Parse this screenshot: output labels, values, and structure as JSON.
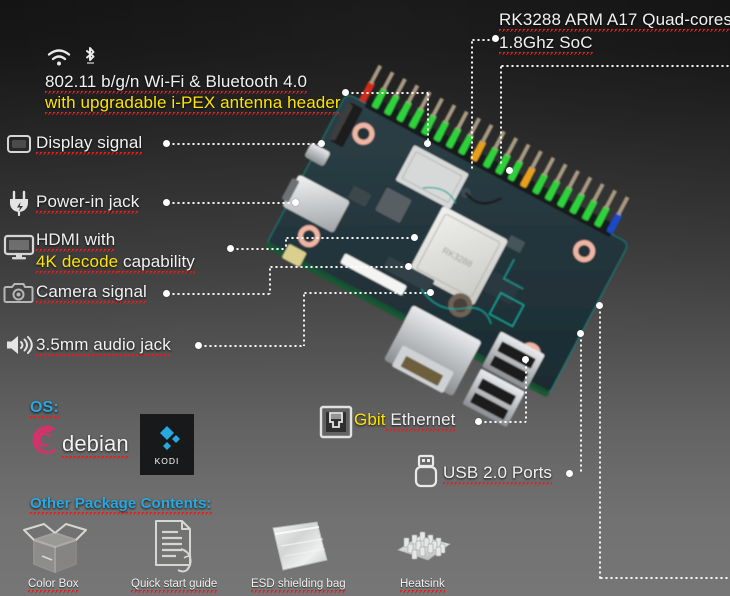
{
  "product": {
    "board_name": "single-board-computer",
    "background": {
      "top_color": "#111111",
      "bottom_color": "#767676"
    }
  },
  "accent_colors": {
    "highlight_yellow": "#ffe400",
    "cyan": "#29a8e0",
    "text": "#f2f2f2",
    "spell_underline": "#e02020"
  },
  "annotations": [
    {
      "id": "wifi-bt",
      "icon": [
        "wifi-icon",
        "bluetooth-icon"
      ],
      "line1": "802.11 b/g/n Wi-Fi  & Bluetooth 4.0",
      "line2": "with upgradable i-PEX antenna header",
      "line2_highlight": true
    },
    {
      "id": "display-signal",
      "icon": "display-connector-icon",
      "text": "Display signal"
    },
    {
      "id": "power-in-jack",
      "icon": "power-plug-icon",
      "text": "Power-in jack"
    },
    {
      "id": "hdmi",
      "icon": "monitor-icon",
      "line1": "HDMI with",
      "line2_prefix": "4K decode",
      "line2_suffix": " capability"
    },
    {
      "id": "camera-signal",
      "icon": "camera-icon",
      "text": "Camera signal"
    },
    {
      "id": "audio-jack",
      "icon": "speaker-icon",
      "text": "3.5mm audio jack"
    },
    {
      "id": "soc",
      "line1": "RK3288 ARM A17 Quad-cores",
      "line2": "1.8Ghz SoC"
    },
    {
      "id": "gbit-ethernet",
      "icon": "rj45-icon",
      "prefix": "Gbit",
      "suffix": " Ethernet"
    },
    {
      "id": "usb-ports",
      "icon": "usb-icon",
      "text": "USB 2.0 Ports"
    }
  ],
  "os_section": {
    "heading": "OS:",
    "items": [
      {
        "id": "debian",
        "label": "debian",
        "logo": "debian-swirl-logo",
        "logo_color": "#d7306a"
      },
      {
        "id": "kodi",
        "label": "KODI",
        "logo": "kodi-logo",
        "logo_color": "#29a8e0",
        "tile_bg": "#18191b"
      }
    ]
  },
  "package_section": {
    "heading": "Other Package Contents:",
    "items": [
      {
        "id": "color-box",
        "caption": "Color Box",
        "icon": "open-box-icon"
      },
      {
        "id": "quick-start-guide",
        "caption": "Quick start guide",
        "icon": "document-hand-icon"
      },
      {
        "id": "esd-bag",
        "caption": "ESD shielding bag",
        "icon": "esd-bag-photo"
      },
      {
        "id": "heatsink",
        "caption": "Heatsink",
        "icon": "heatsink-photo"
      }
    ]
  }
}
